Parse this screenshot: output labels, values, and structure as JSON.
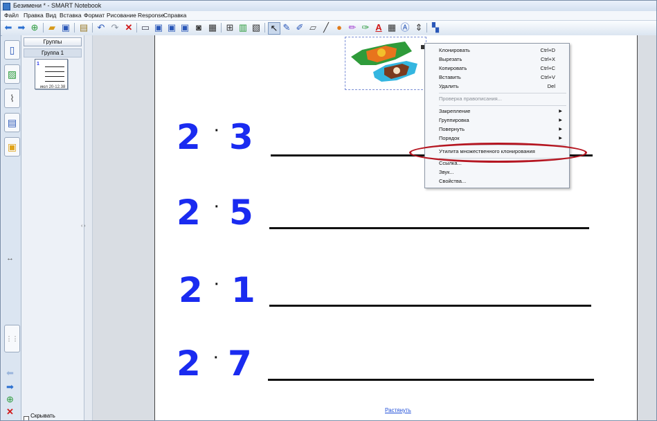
{
  "window": {
    "title": "Безимени * - SMART Notebook"
  },
  "menu": {
    "items": [
      "Файл",
      "Правка",
      "Вид",
      "Вставка",
      "Формат",
      "Рисование",
      "Response",
      "Справка"
    ]
  },
  "toolbar": {
    "icons": [
      "back-icon",
      "forward-icon",
      "add-page-icon",
      "open-icon",
      "save-icon",
      "paste-icon",
      "undo-icon",
      "redo-icon",
      "delete-icon",
      "screen-shade-icon",
      "display-icon",
      "monitor-icon",
      "table-icon",
      "document-camera-icon",
      "capture-icon",
      "insert-icon",
      "select-icon",
      "pen-icon",
      "creative-pen-icon",
      "eraser-icon",
      "line-icon",
      "shape-icon",
      "magic-pen-icon",
      "fill-icon",
      "text-icon",
      "properties-icon",
      "recognize-icon",
      "move-toolbar-icon",
      "customize-icon"
    ]
  },
  "pages_panel": {
    "groups_button": "Группы",
    "group_label": "Группа 1",
    "thumbnail_caption": "июл 20-12.38",
    "auto_hide_label": "Скрывать автоматическ"
  },
  "page": {
    "expressions": [
      {
        "left": "2",
        "right": "3"
      },
      {
        "left": "2",
        "right": "5"
      },
      {
        "left": "2",
        "right": "1"
      },
      {
        "left": "2",
        "right": "7"
      }
    ],
    "dot": "·",
    "stretch_link": "Растянуть"
  },
  "context_menu": {
    "items": [
      {
        "label": "Клонировать",
        "shortcut": "Ctrl+D"
      },
      {
        "label": "Вырезать",
        "shortcut": "Ctrl+X"
      },
      {
        "label": "Копировать",
        "shortcut": "Ctrl+C"
      },
      {
        "label": "Вставить",
        "shortcut": "Ctrl+V"
      },
      {
        "label": "Удалить",
        "shortcut": "Del"
      },
      {
        "label": "Проверка правописания...",
        "disabled": true
      },
      {
        "label": "Закрепление",
        "submenu": true
      },
      {
        "label": "Группировка",
        "submenu": true
      },
      {
        "label": "Повернуть",
        "submenu": true
      },
      {
        "label": "Порядок",
        "submenu": true
      },
      {
        "label": "Утилита множественного клонирования",
        "highlighted": true
      },
      {
        "label": "Ссылка..."
      },
      {
        "label": "Звук..."
      },
      {
        "label": "Свойства..."
      }
    ]
  },
  "colors": {
    "expression_blue": "#1a2bf0",
    "highlight_red": "#b51621"
  }
}
